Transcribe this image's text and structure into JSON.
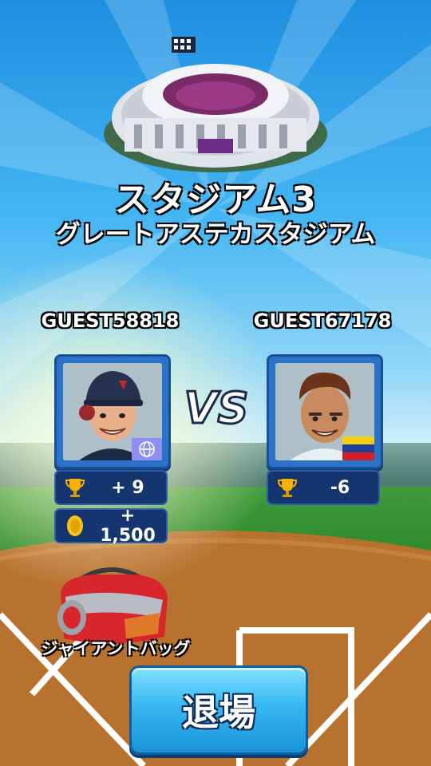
{
  "stadium": {
    "name": "スタジアム3",
    "subtitle": "グレートアステカスタジアム"
  },
  "match": {
    "vs_label": "VS",
    "player1": {
      "name": "GUEST58818",
      "flag": "globe-flag-icon",
      "trophies": "+ 9",
      "coins": "+ 1,500"
    },
    "player2": {
      "name": "GUEST67178",
      "flag": "venezuela-flag-icon",
      "trophies": "-6"
    }
  },
  "reward": {
    "label": "ジャイアントバッグ"
  },
  "exit_button": {
    "label": "退場"
  },
  "colors": {
    "panel": "#2b73c9",
    "stat_bg": "#15356e",
    "button": "#37b7f0",
    "trophy": "#f5b300",
    "coin": "#f7c21a"
  }
}
